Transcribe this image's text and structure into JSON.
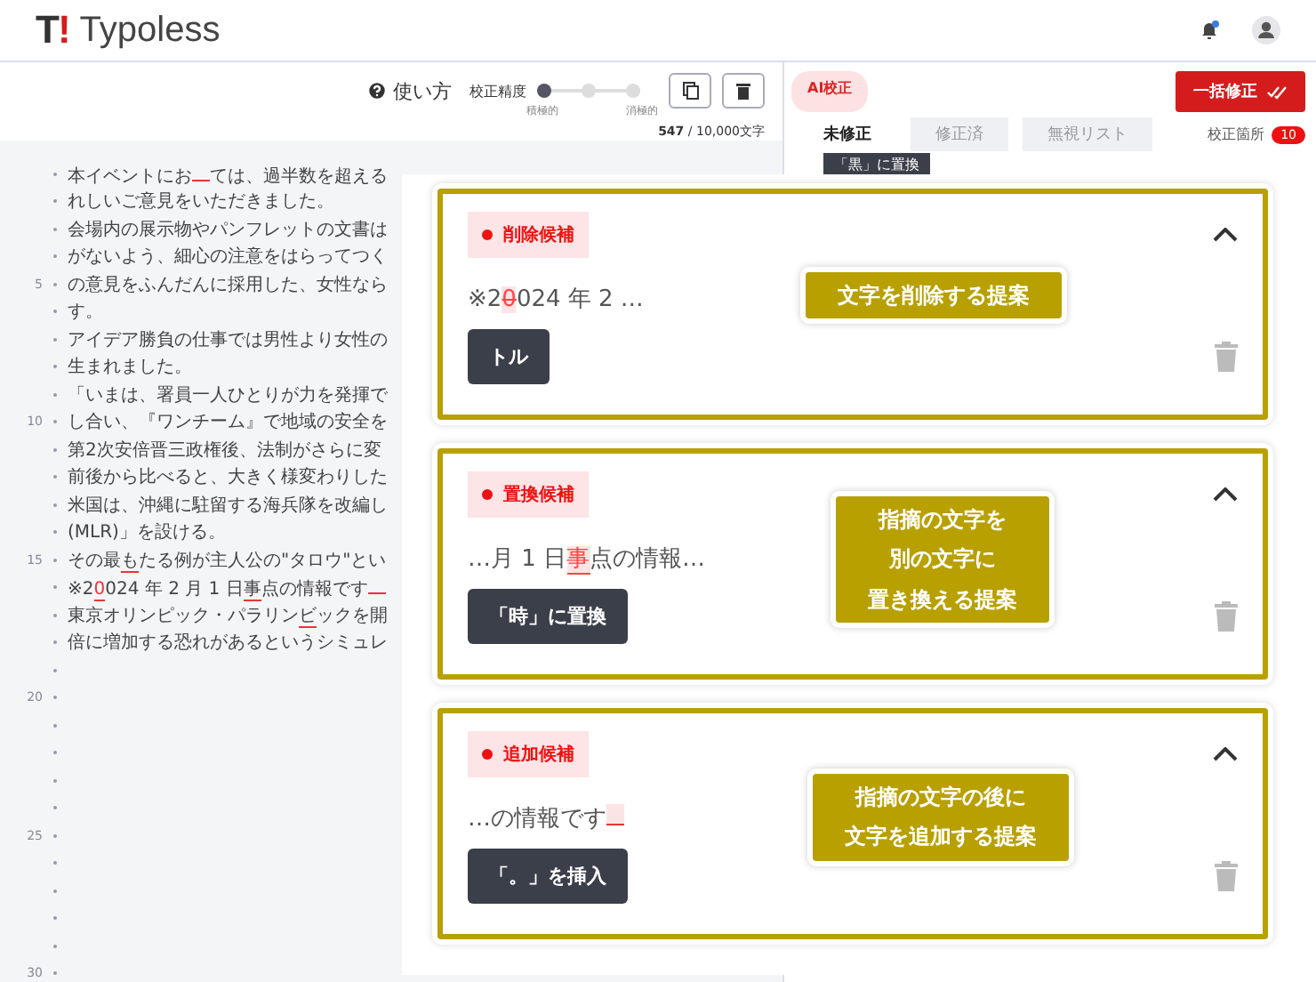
{
  "header": {
    "logo_mark": "T!",
    "logo_text": "Typoless",
    "notification_dot": true
  },
  "toolbar": {
    "help": "使い方",
    "accuracy": {
      "label": "校正精度",
      "level": 0,
      "min_label": "積極的",
      "max_label": "消極的"
    },
    "count": "**547** / 10,000文字"
  },
  "editor": {
    "lines": [
      {
        "kind": "text",
        "segments": [
          {
            "kind": "plain",
            "text": "本イベントにお"
          },
          {
            "kind": "gap"
          },
          {
            "kind": "plain",
            "text": "ては、過半数を超える"
          }
        ]
      },
      {
        "kind": "text",
        "segments": [
          {
            "kind": "plain",
            "text": "れしいご意見をいただきました。"
          }
        ]
      },
      {
        "kind": "text",
        "segments": [
          {
            "kind": "plain",
            "text": "会場内の展示物やパンフレットの文書は"
          }
        ]
      },
      {
        "kind": "text",
        "segments": [
          {
            "kind": "plain",
            "text": "がないよう、細心の注意をはらってつく"
          }
        ]
      },
      {
        "kind": "text",
        "number": "5",
        "segments": [
          {
            "kind": "plain",
            "text": "の意見をふんだんに採用した、女性なら"
          }
        ]
      },
      {
        "kind": "text",
        "segments": [
          {
            "kind": "plain",
            "text": "す。"
          }
        ]
      },
      {
        "kind": "text",
        "segments": [
          {
            "kind": "plain",
            "text": "アイデア勝負の仕事では男性より女性の"
          }
        ]
      },
      {
        "kind": "text",
        "segments": [
          {
            "kind": "plain",
            "text": "生まれました。"
          }
        ]
      },
      {
        "kind": "text",
        "segments": [
          {
            "kind": "plain",
            "text": "「いまは、署員一人ひとりが力を発揮で"
          }
        ]
      },
      {
        "kind": "text",
        "number": "10",
        "segments": [
          {
            "kind": "plain",
            "text": "し合い、『ワンチーム』で地域の安全を"
          }
        ]
      },
      {
        "kind": "text",
        "segments": [
          {
            "kind": "plain",
            "text": "第2次安倍晋三政権後、法制がさらに変"
          }
        ]
      },
      {
        "kind": "text",
        "segments": [
          {
            "kind": "plain",
            "text": "前後から比べると、大きく様変わりした"
          }
        ]
      },
      {
        "kind": "text",
        "segments": [
          {
            "kind": "plain",
            "text": "米国は、沖縄に駐留する海兵隊を改編し"
          }
        ]
      },
      {
        "kind": "text",
        "segments": [
          {
            "kind": "plain",
            "text": "(MLR)」を設ける。"
          }
        ]
      },
      {
        "kind": "text",
        "number": "15",
        "segments": [
          {
            "kind": "plain",
            "text": "その最"
          },
          {
            "kind": "replace",
            "text": "も"
          },
          {
            "kind": "plain",
            "text": "たる例が主人公の\"タロウ\"とい"
          }
        ]
      },
      {
        "kind": "text",
        "segments": [
          {
            "kind": "plain",
            "text": "※2"
          },
          {
            "kind": "delete",
            "text": "0"
          },
          {
            "kind": "plain",
            "text": "024 年 2 月 1 日"
          },
          {
            "kind": "replace",
            "text": "事"
          },
          {
            "kind": "plain",
            "text": "点の情報です"
          },
          {
            "kind": "gap"
          }
        ]
      },
      {
        "kind": "text",
        "segments": [
          {
            "kind": "plain",
            "text": "東京オリンピック・パラリン"
          },
          {
            "kind": "replace",
            "text": "ビ"
          },
          {
            "kind": "plain",
            "text": "ックを開"
          }
        ]
      },
      {
        "kind": "text",
        "segments": [
          {
            "kind": "plain",
            "text": "倍に増加する恐れがあるというシミュレ"
          }
        ]
      },
      {
        "kind": "blank"
      },
      {
        "kind": "blank",
        "number": "20"
      },
      {
        "kind": "blank"
      },
      {
        "kind": "blank"
      },
      {
        "kind": "blank"
      },
      {
        "kind": "blank"
      },
      {
        "kind": "blank",
        "number": "25"
      },
      {
        "kind": "blank"
      },
      {
        "kind": "blank"
      },
      {
        "kind": "blank"
      },
      {
        "kind": "blank"
      },
      {
        "kind": "blank",
        "number": "30"
      }
    ]
  },
  "panel": {
    "ai_label": "AI校正",
    "fix_all": "一括修正",
    "tabs": [
      {
        "label": "未修正",
        "selected": true
      },
      {
        "label": "修正済",
        "selected": false
      },
      {
        "label": "無視リスト",
        "selected": false
      }
    ],
    "count_label": "校正箇所",
    "count": "10",
    "peek_button": "「黒」に置換"
  },
  "suggestions": [
    {
      "kind": "delete",
      "tag": "削除候補",
      "snippet": [
        {
          "kind": "plain",
          "text": "※2"
        },
        {
          "kind": "delete",
          "text": "0"
        },
        {
          "kind": "plain",
          "text": "024 年 2 …"
        }
      ],
      "action": "トル",
      "expanded": true,
      "callout": [
        "文字を削除する提案"
      ]
    },
    {
      "kind": "replace",
      "tag": "置換候補",
      "snippet": [
        {
          "kind": "plain",
          "text": "…月 1 日"
        },
        {
          "kind": "replace",
          "text": "事"
        },
        {
          "kind": "plain",
          "text": "点の情報…"
        }
      ],
      "action": "「時」に置換",
      "expanded": true,
      "callout": [
        "指摘の文字を",
        "別の文字に",
        "置き換える提案"
      ]
    },
    {
      "kind": "add",
      "tag": "追加候補",
      "snippet": [
        {
          "kind": "plain",
          "text": "…の情報です"
        },
        {
          "kind": "gap"
        }
      ],
      "action": "「。」を挿入",
      "expanded": true,
      "callout": [
        "指摘の文字の後に",
        "文字を追加する提案"
      ]
    }
  ]
}
